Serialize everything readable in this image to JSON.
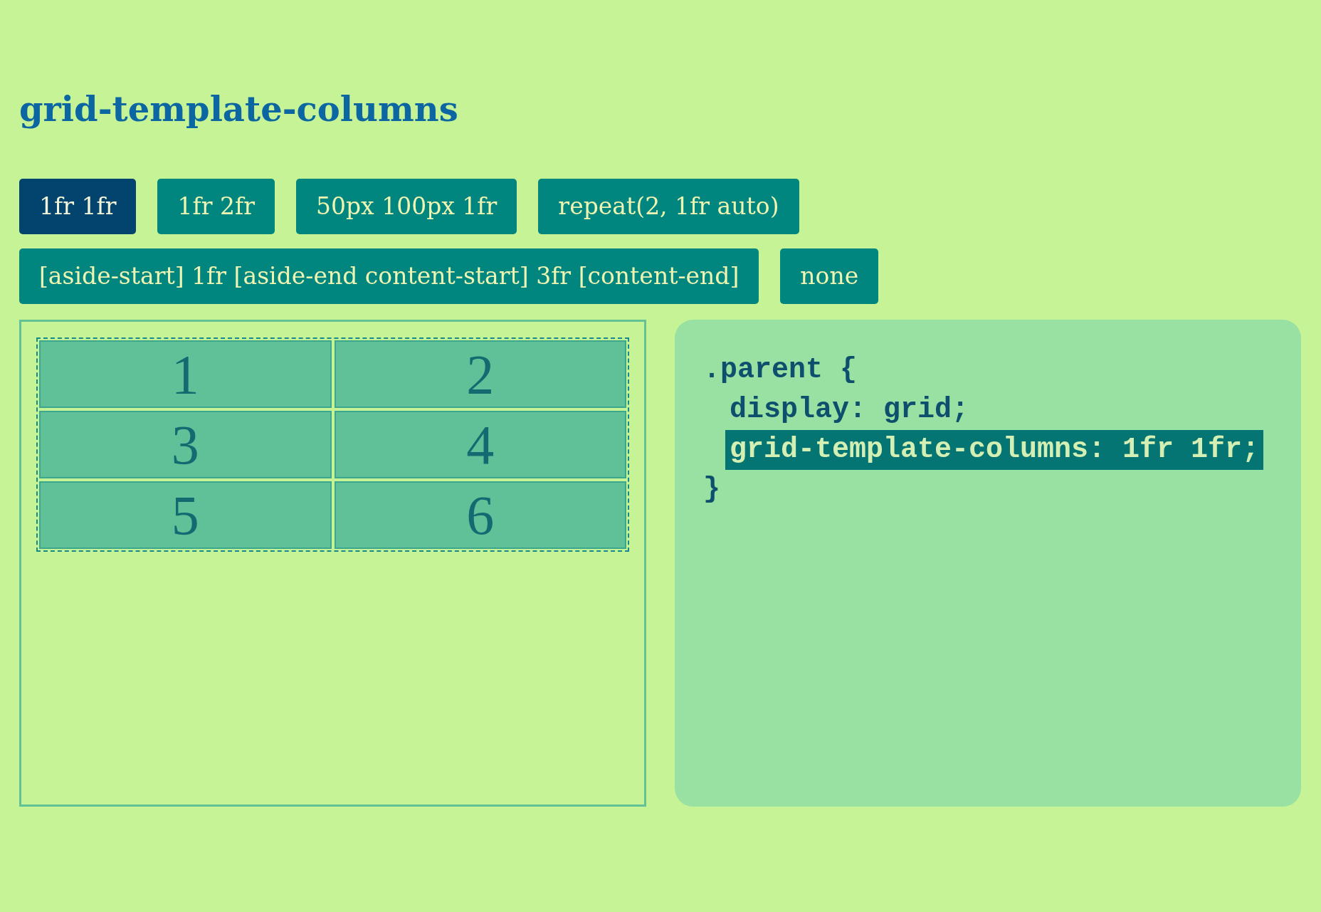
{
  "title": "grid-template-columns",
  "options": [
    {
      "label": "1fr 1fr",
      "selected": true
    },
    {
      "label": "1fr 2fr",
      "selected": false
    },
    {
      "label": "50px 100px 1fr",
      "selected": false
    },
    {
      "label": "repeat(2, 1fr auto)",
      "selected": false
    },
    {
      "label": "[aside-start] 1fr [aside-end content-start] 3fr [content-end]",
      "selected": false
    },
    {
      "label": "none",
      "selected": false
    }
  ],
  "grid_demo": {
    "items": [
      "1",
      "2",
      "3",
      "4",
      "5",
      "6"
    ]
  },
  "code": {
    "opening": ".parent {",
    "declarations": [
      {
        "text": "display: grid;",
        "highlighted": false
      },
      {
        "text": "grid-template-columns: 1fr 1fr;",
        "highlighted": true
      }
    ],
    "closing": "}"
  }
}
